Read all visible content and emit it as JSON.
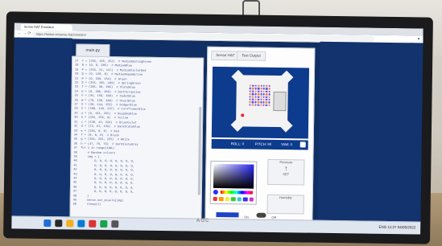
{
  "browser": {
    "tab_title": "Sense HAT Emulator",
    "url": "https://trinket.io/sense-hat/emulator",
    "nav_glyphs": "← → ⟳"
  },
  "editor": {
    "tab_label": "main.py",
    "code_lines": [
      "17  Y = (255, 165, 252)  # MediumSpringGreen",
      "18  N = (0, 0, 205)  # MediumBlue",
      "19  P = (255, 21, 147)  # MediumVioletRed",
      "20  Q = (0, 128, 0)  # MediumAquamarine",
      "21  R = (0, 250, 154)  # Green",
      "22  S = (255, 165, 183)  # SpringGreen",
      "23  T = (106, 90, 205)  # SlateBlue",
      "24  U = (0, 206, 209)  # DarkTurquoise",
      "25  V = (95, 158, 160)  # CadetBlue",
      "26  W = (70, 130, 180)  # SteelBlue",
      "27  X = (30, 144, 255)  # DodgerBlue",
      "28  Z = (100, 149, 237)  # CornflowerBlue",
      "29  a = (0, 191, 255)  # DeepSkyBlue",
      "30  b = (255, 255, 0)  # Yellow",
      "31  c = (138, 43, 226)  # BlueViolet",
      "32  d = (72, 61, 139)  # DarkSlateBlue",
      "33  e = (255, 0, 0)  # Red",
      "34  f = (0, 0, 0)  # Black",
      "35  g = (255, 255, 255)  # White",
      "36  h = (47, 79, 79)  # DarkSlateGray",
      "37  for i in range(100):",
      "38      # Random colours",
      "39      img = [",
      "40          O, O, O, O, O, O, O, O,",
      "41          O, O, O, O, O, O, O, O,",
      "42          O, O, O, O, O, O, O, O,",
      "43          O, O, O, O, O, O, O, O,",
      "44          O, O, O, O, O, O, O, O,",
      "45          O, O, O, O, O, O, O, O,",
      "46          O, O, O, O, O, O, O, O,",
      "47          O, O, O, O, O, O, O, O,",
      "48      ]",
      "49      sense.set_pixels(img)",
      "50      sleep(1)"
    ],
    "run_label": "Stop"
  },
  "simulator": {
    "tabs": [
      "Sense HAT",
      "Text Output"
    ],
    "roll_label": "ROLL: 0",
    "pitch_label": "PITCH: 90",
    "yaw_label": "YAW: 0",
    "humidity_label": "Humidity",
    "pressure_label": "Pressure",
    "set_label": "SET",
    "on_label": "On",
    "off_label": "Off"
  },
  "taskbar": {
    "search_hint": "Type here to search",
    "time": "11:27",
    "date": "04/05/2022",
    "locale": "ENG"
  },
  "monitor": {
    "brand": "AOC"
  },
  "colors": {
    "panel_blue": "#12336d",
    "led_purple": "#6a4fe0",
    "accent_blue": "#1e44c6"
  }
}
